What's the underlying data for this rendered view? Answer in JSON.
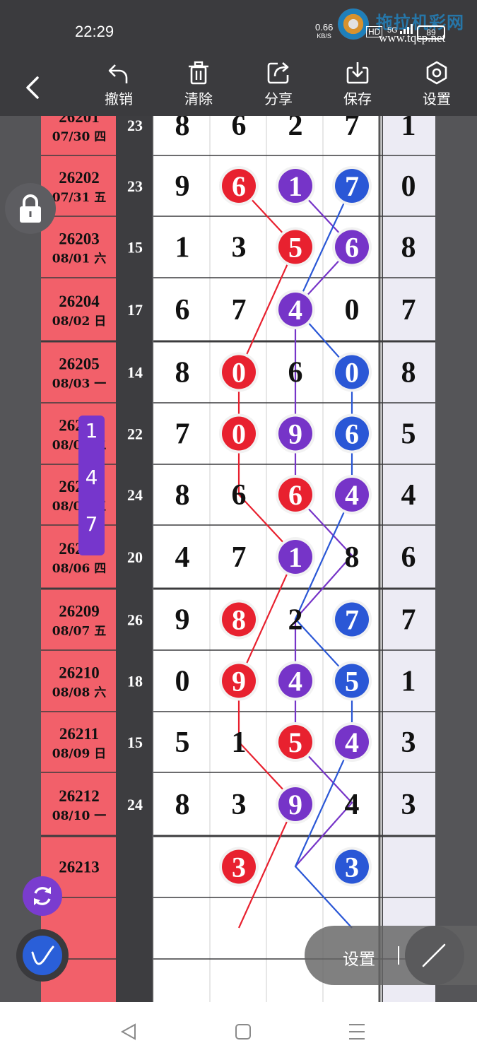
{
  "status_bar": {
    "time": "22:29",
    "net_speed_value": "0.66",
    "net_speed_unit": "KB/S",
    "hd": "HD",
    "signal": "5G",
    "battery": "89",
    "watermark_url": "www.tqcp.net",
    "watermark_title": "拖拉机彩网"
  },
  "toolbar": {
    "undo": "撤销",
    "clear": "清除",
    "share": "分享",
    "save": "保存",
    "settings": "设置"
  },
  "colors": {
    "red": "#e8212f",
    "purple": "#7634c8",
    "blue": "#2a57d6",
    "row_header": "#f2606a",
    "sum_column": "#3d3d40",
    "last_column": "#ecebf4"
  },
  "rows": [
    {
      "issue": "26201",
      "date": "07/30 四",
      "sum": "23",
      "digits": [
        "8",
        "6",
        "2",
        "7"
      ],
      "span": "1",
      "marks": {}
    },
    {
      "issue": "26202",
      "date": "07/31 五",
      "sum": "23",
      "digits": [
        "9",
        "6",
        "1",
        "7"
      ],
      "span": "0",
      "marks": {
        "1": "red",
        "2": "purple",
        "3": "blue"
      }
    },
    {
      "issue": "26203",
      "date": "08/01 六",
      "sum": "15",
      "digits": [
        "1",
        "3",
        "5",
        "6"
      ],
      "span": "8",
      "marks": {
        "2": "red",
        "3": "purple"
      }
    },
    {
      "issue": "26204",
      "date": "08/02 日",
      "sum": "17",
      "digits": [
        "6",
        "7",
        "4",
        "0"
      ],
      "span": "7",
      "marks": {
        "2": "purple"
      }
    },
    {
      "issue": "26205",
      "date": "08/03 一",
      "sum": "14",
      "digits": [
        "8",
        "0",
        "6",
        "0"
      ],
      "span": "8",
      "marks": {
        "1": "red",
        "3": "blue"
      }
    },
    {
      "issue": "26206",
      "date": "08/04 二",
      "sum": "22",
      "digits": [
        "7",
        "0",
        "9",
        "6"
      ],
      "span": "5",
      "marks": {
        "1": "red",
        "2": "purple",
        "3": "blue"
      }
    },
    {
      "issue": "26207",
      "date": "08/05 三",
      "sum": "24",
      "digits": [
        "8",
        "6",
        "6",
        "4"
      ],
      "span": "4",
      "marks": {
        "2": "red",
        "3": "purple"
      }
    },
    {
      "issue": "26208",
      "date": "08/06 四",
      "sum": "20",
      "digits": [
        "4",
        "7",
        "1",
        "8"
      ],
      "span": "6",
      "marks": {
        "2": "purple"
      }
    },
    {
      "issue": "26209",
      "date": "08/07 五",
      "sum": "26",
      "digits": [
        "9",
        "8",
        "2",
        "7"
      ],
      "span": "7",
      "marks": {
        "1": "red",
        "3": "blue"
      }
    },
    {
      "issue": "26210",
      "date": "08/08 六",
      "sum": "18",
      "digits": [
        "0",
        "9",
        "4",
        "5"
      ],
      "span": "1",
      "marks": {
        "1": "red",
        "2": "purple",
        "3": "blue"
      }
    },
    {
      "issue": "26211",
      "date": "08/09 日",
      "sum": "15",
      "digits": [
        "5",
        "1",
        "5",
        "4"
      ],
      "span": "3",
      "marks": {
        "2": "red",
        "3": "purple"
      }
    },
    {
      "issue": "26212",
      "date": "08/10 一",
      "sum": "24",
      "digits": [
        "8",
        "3",
        "9",
        "4"
      ],
      "span": "3",
      "marks": {
        "2": "purple"
      }
    },
    {
      "issue": "26213",
      "date": "",
      "sum": "",
      "digits": [
        "",
        "3",
        "",
        "3"
      ],
      "span": "",
      "marks": {
        "1": "red",
        "3": "blue"
      }
    },
    {
      "issue": "",
      "date": "",
      "sum": "",
      "digits": [
        "",
        "",
        "",
        ""
      ],
      "span": "",
      "marks": {}
    },
    {
      "issue": "",
      "date": "",
      "sum": "",
      "digits": [
        "",
        "",
        "",
        ""
      ],
      "span": "",
      "marks": {}
    }
  ],
  "lines": [
    {
      "color": "red",
      "points": [
        [
          1,
          1
        ],
        [
          2,
          2
        ],
        [
          4,
          1
        ],
        [
          6,
          1
        ],
        [
          7,
          2
        ],
        [
          9,
          1
        ],
        [
          10,
          1
        ],
        [
          11,
          2
        ],
        [
          13,
          1
        ]
      ]
    },
    {
      "color": "purple",
      "points": [
        [
          1,
          2
        ],
        [
          2,
          3
        ],
        [
          3,
          2
        ],
        [
          6,
          2
        ],
        [
          7,
          3
        ],
        [
          8,
          2
        ],
        [
          10,
          2
        ],
        [
          11,
          3
        ],
        [
          12,
          2
        ]
      ]
    },
    {
      "color": "blue",
      "points": [
        [
          1,
          3
        ],
        [
          3,
          2
        ],
        [
          4,
          3
        ],
        [
          6,
          3
        ],
        [
          8,
          2
        ],
        [
          9,
          3
        ],
        [
          10,
          3
        ],
        [
          12,
          2
        ],
        [
          13,
          3
        ]
      ]
    }
  ],
  "popup_digits": [
    "1",
    "4",
    "7"
  ],
  "floating_bar": {
    "settings_label": "设置"
  }
}
